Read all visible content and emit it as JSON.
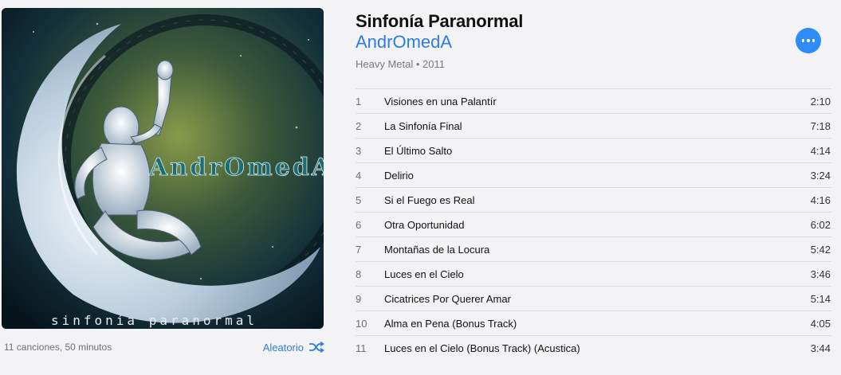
{
  "album": {
    "title": "Sinfonía Paranormal",
    "artist": "AndrOmedA",
    "meta": "Heavy Metal • 2011",
    "summary": "11 canciones, 50 minutos",
    "shuffle_label": "Aleatorio",
    "cover_logo": "AndrOmedA",
    "cover_caption": "sinfonía paranormal"
  },
  "colors": {
    "accent": "#2f7be5",
    "more_button": "#2e8cf6"
  },
  "icons": {
    "shuffle": "shuffle-icon",
    "more": "more-icon"
  },
  "tracks": [
    {
      "num": "1",
      "title": "Visiones en una Palantír",
      "duration": "2:10"
    },
    {
      "num": "2",
      "title": "La Sinfonía Final",
      "duration": "7:18"
    },
    {
      "num": "3",
      "title": "El Último Salto",
      "duration": "4:14"
    },
    {
      "num": "4",
      "title": "Delirio",
      "duration": "3:24"
    },
    {
      "num": "5",
      "title": "Si el Fuego es Real",
      "duration": "4:16"
    },
    {
      "num": "6",
      "title": "Otra Oportunidad",
      "duration": "6:02"
    },
    {
      "num": "7",
      "title": "Montañas de la Locura",
      "duration": "5:42"
    },
    {
      "num": "8",
      "title": "Luces en el Cielo",
      "duration": "3:46"
    },
    {
      "num": "9",
      "title": "Cicatrices Por Querer Amar",
      "duration": "5:14"
    },
    {
      "num": "10",
      "title": "Alma en Pena (Bonus Track)",
      "duration": "4:05"
    },
    {
      "num": "11",
      "title": "Luces en el Cielo (Bonus Track) (Acustica)",
      "duration": "3:44"
    }
  ]
}
